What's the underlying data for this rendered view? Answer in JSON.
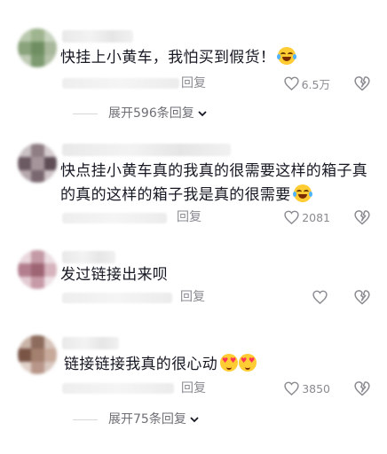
{
  "comments": [
    {
      "text": "快挂上小黄车，我怕买到假货！",
      "emoji_names": [
        "laughing-crying-emoji"
      ],
      "reply_label": "回复",
      "like_count": "6.5万",
      "expand_label": "展开596条回复"
    },
    {
      "text": "快点挂小黄车真的我真的很需要这样的箱子真的真的这样的箱子我是真的很需要",
      "emoji_names": [
        "laughing-crying-emoji"
      ],
      "reply_label": "回复",
      "like_count": "2081"
    },
    {
      "text": "发过链接出来呗",
      "reply_label": "回复",
      "like_count": ""
    },
    {
      "text": "链接链接我真的很心动",
      "emoji_names": [
        "heart-eyes-emoji",
        "heart-eyes-emoji"
      ],
      "reply_label": "回复",
      "like_count": "3850",
      "expand_label": "展开75条回复"
    }
  ],
  "colors": {
    "text": "#161823",
    "secondary": "#8a8b91",
    "emoji_yellow": "#ffcc33"
  }
}
